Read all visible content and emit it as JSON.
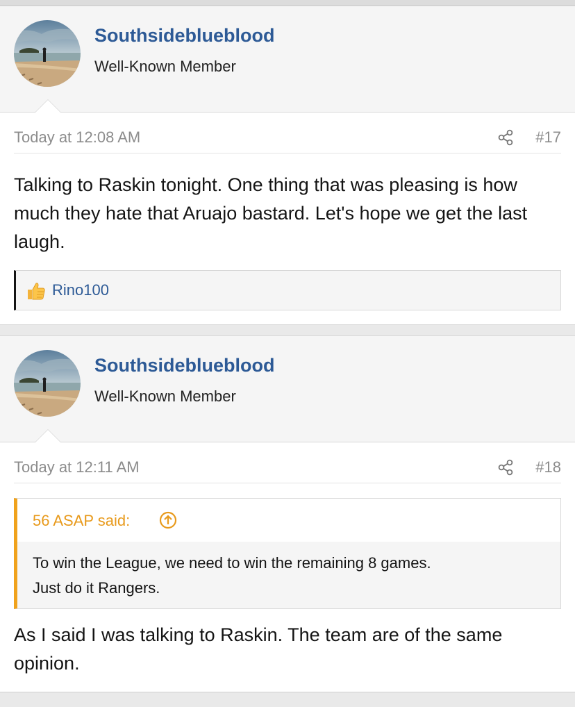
{
  "posts": [
    {
      "username": "Southsideblueblood",
      "user_title": "Well-Known Member",
      "timestamp": "Today at 12:08 AM",
      "post_number": "#17",
      "body": "Talking to Raskin tonight. One thing that was pleasing is how much they hate that Aruajo bastard. Let's hope we get the last laugh.",
      "reactions": {
        "icon": "thumbs-up-icon",
        "users": "Rino100"
      }
    },
    {
      "username": "Southsideblueblood",
      "user_title": "Well-Known Member",
      "timestamp": "Today at 12:11 AM",
      "post_number": "#18",
      "quote": {
        "author": "56 ASAP said:",
        "line1": "To win the League, we need to win the remaining 8 games.",
        "line2": "Just do it Rangers."
      },
      "body": "As I said I was talking to Raskin. The team are of the same opinion."
    }
  ],
  "colors": {
    "username": "#2d5a96",
    "quote_accent": "#f0a21c",
    "meta_text": "#8c8c8c"
  }
}
